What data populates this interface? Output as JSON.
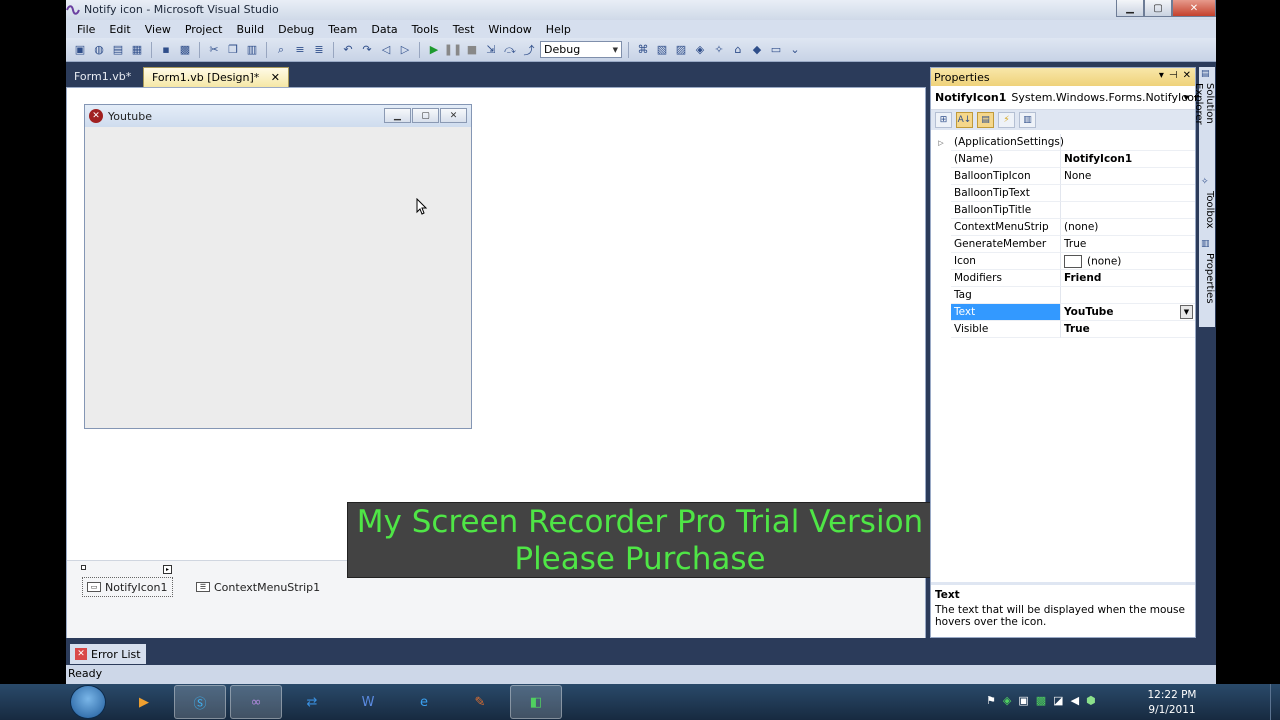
{
  "window": {
    "title": "Notify icon - Microsoft Visual Studio"
  },
  "menu": [
    "File",
    "Edit",
    "View",
    "Project",
    "Build",
    "Debug",
    "Team",
    "Data",
    "Tools",
    "Test",
    "Window",
    "Help"
  ],
  "toolbar": {
    "config": "Debug"
  },
  "tabs": [
    {
      "label": "Form1.vb*",
      "active": false
    },
    {
      "label": "Form1.vb [Design]*",
      "active": true,
      "close": "✕"
    }
  ],
  "form": {
    "caption": "Youtube"
  },
  "tray": {
    "items": [
      "NotifyIcon1",
      "ContextMenuStrip1"
    ]
  },
  "watermark": {
    "line1": "My Screen Recorder Pro Trial Version",
    "line2": "Please Purchase"
  },
  "properties": {
    "header": "Properties",
    "object_name": "NotifyIcon1",
    "object_type": "System.Windows.Forms.NotifyIcon",
    "rows": [
      {
        "name": "(ApplicationSettings)",
        "value": "",
        "expander": "▷"
      },
      {
        "name": "(Name)",
        "value": "NotifyIcon1",
        "bold": true
      },
      {
        "name": "BalloonTipIcon",
        "value": "None"
      },
      {
        "name": "BalloonTipText",
        "value": ""
      },
      {
        "name": "BalloonTipTitle",
        "value": ""
      },
      {
        "name": "ContextMenuStrip",
        "value": "(none)"
      },
      {
        "name": "GenerateMember",
        "value": "True"
      },
      {
        "name": "Icon",
        "value": "(none)"
      },
      {
        "name": "Modifiers",
        "value": "Friend",
        "bold": true
      },
      {
        "name": "Tag",
        "value": ""
      },
      {
        "name": "Text",
        "value": "YouTube",
        "bold": true,
        "selected": true
      },
      {
        "name": "Visible",
        "value": "True",
        "bold": true
      }
    ],
    "desc_title": "Text",
    "desc_text": "The text that will be displayed when the mouse hovers over the icon."
  },
  "side_tabs": [
    "Solution Explorer",
    "Toolbox",
    "Properties"
  ],
  "error_list": "Error List",
  "status": "Ready",
  "clock": {
    "time": "12:22 PM",
    "date": "9/1/2011"
  },
  "colors": {
    "selection": "#3399ff",
    "watermark_text": "#4fe646",
    "ide_background": "#2b3b5a"
  }
}
